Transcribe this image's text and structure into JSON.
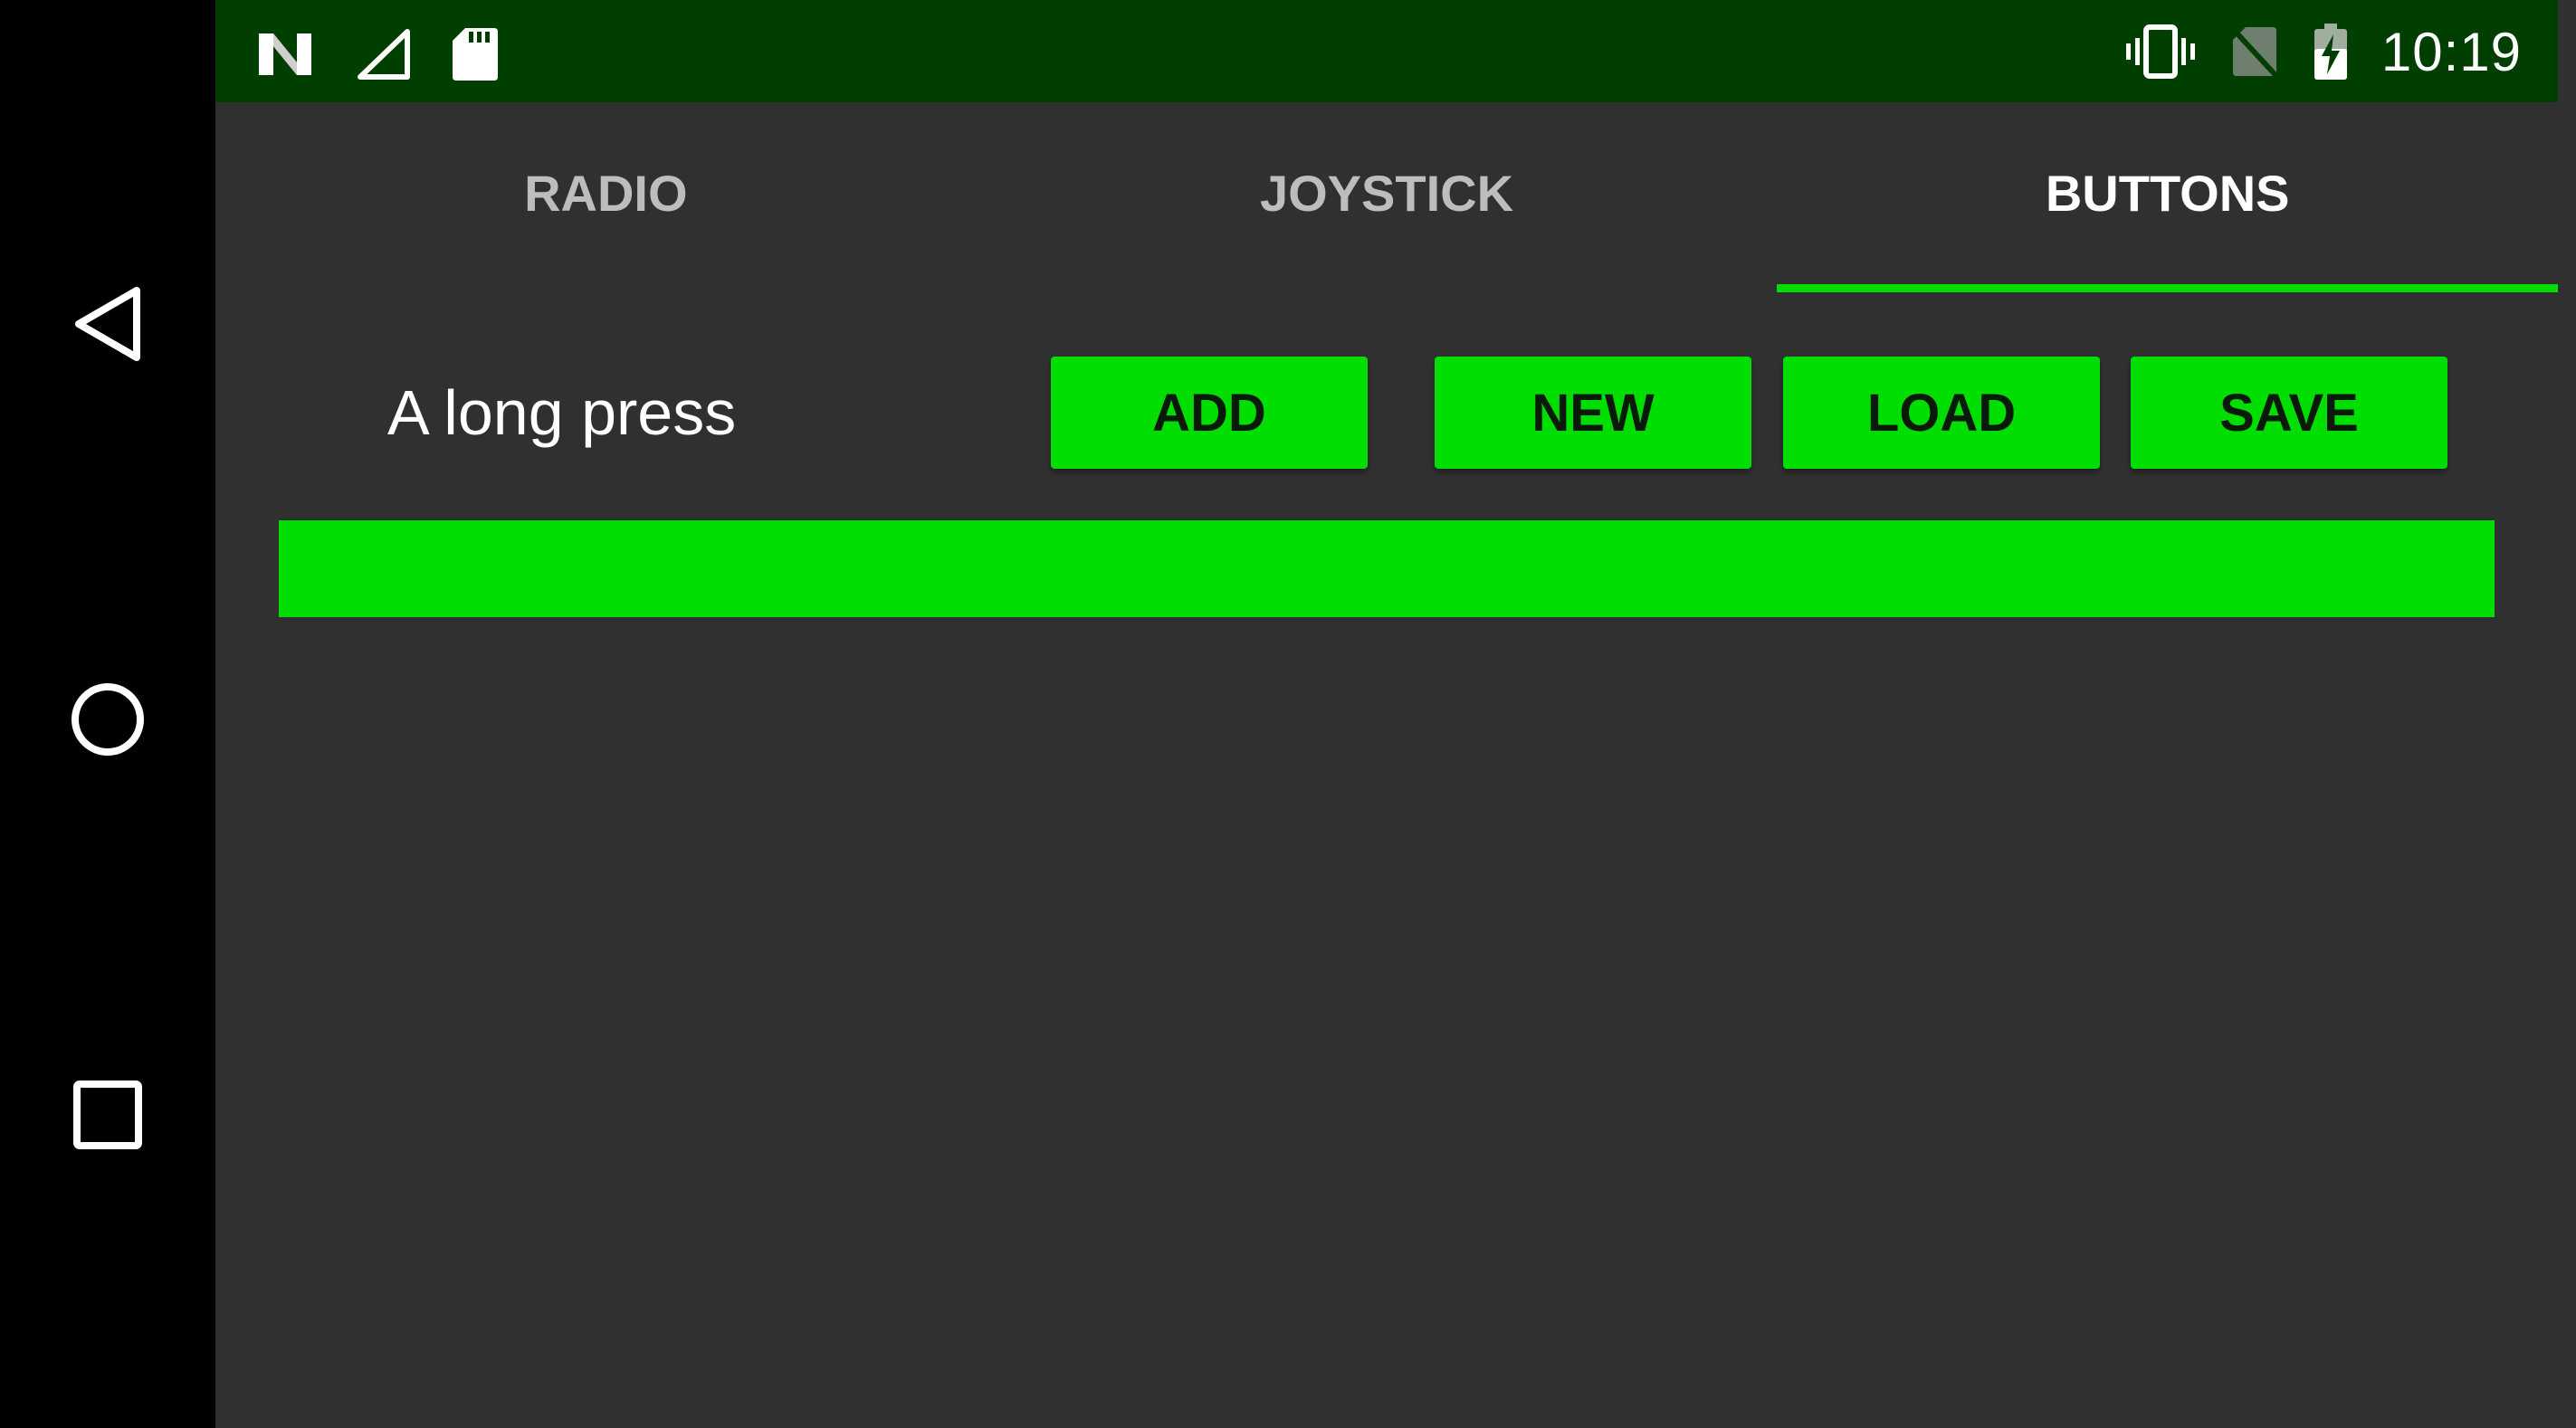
{
  "status_bar": {
    "time": "10:19",
    "left_icons": [
      "n-logo-icon",
      "signal-icon",
      "sd-card-icon"
    ],
    "right_icons": [
      "vibrate-icon",
      "no-sim-icon",
      "battery-charging-icon"
    ]
  },
  "tabs": [
    {
      "label": "RADIO",
      "active": false
    },
    {
      "label": "JOYSTICK",
      "active": false
    },
    {
      "label": "BUTTONS",
      "active": true
    }
  ],
  "controls": {
    "spinner_value": "A long press",
    "add_label": "ADD",
    "new_label": "NEW",
    "load_label": "LOAD",
    "save_label": "SAVE"
  },
  "colors": {
    "accent": "#00dd00",
    "status_bar": "#003f00",
    "background": "#303030",
    "nav_bar": "#000000"
  }
}
